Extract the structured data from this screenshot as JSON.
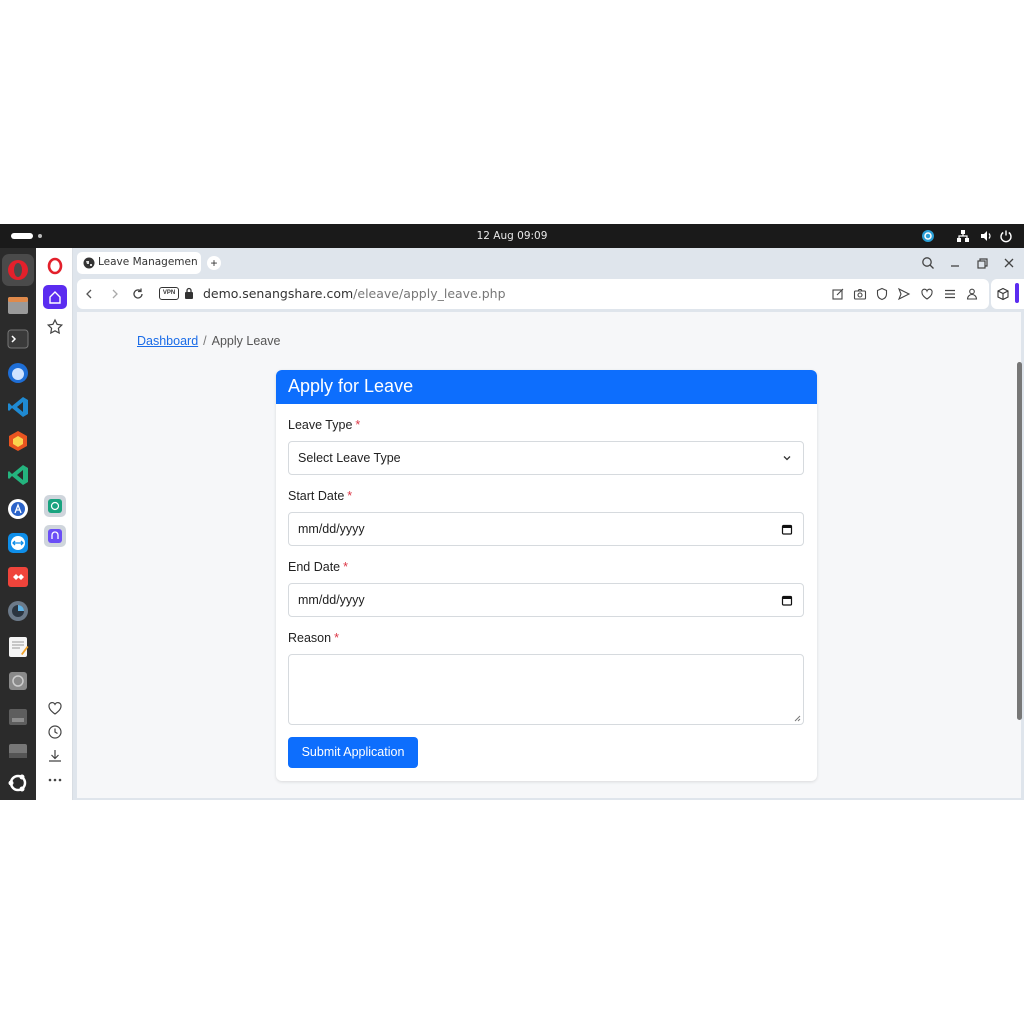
{
  "topbar": {
    "clock": "12 Aug  09:09",
    "icons": [
      "activities-icon",
      "update-icon",
      "network-icon",
      "volume-icon",
      "power-icon"
    ]
  },
  "dock": {
    "apps": [
      "opera-icon",
      "files-icon",
      "terminal-icon",
      "thunderbird-icon",
      "vscode-icon",
      "app-store-icon",
      "vscode-insiders-icon",
      "software-icon",
      "teamviewer-icon",
      "anydesk-icon",
      "disk-usage-icon",
      "text-editor-icon",
      "disk-icon",
      "ssd-icon",
      "drive-icon",
      "ubuntu-icon"
    ]
  },
  "browser": {
    "tab_title": "Leave Management",
    "new_tab": "+",
    "url_host": "demo.senangshare.com",
    "url_path": "/eleave/apply_leave.php",
    "vpn_label": "VPN",
    "accent": "#5b2cf0"
  },
  "page": {
    "breadcrumb": {
      "link": "Dashboard",
      "separator": "/",
      "current": "Apply Leave"
    },
    "form": {
      "title": "Apply for Leave",
      "leave_type_label": "Leave Type",
      "leave_type_value": "Select Leave Type",
      "start_date_label": "Start Date",
      "start_date_value": "mm/dd/yyyy",
      "end_date_label": "End Date",
      "end_date_value": "mm/dd/yyyy",
      "reason_label": "Reason",
      "required_mark": "*",
      "submit_label": "Submit Application"
    },
    "colors": {
      "primary": "#0d6efd",
      "required": "#dc3545"
    }
  }
}
